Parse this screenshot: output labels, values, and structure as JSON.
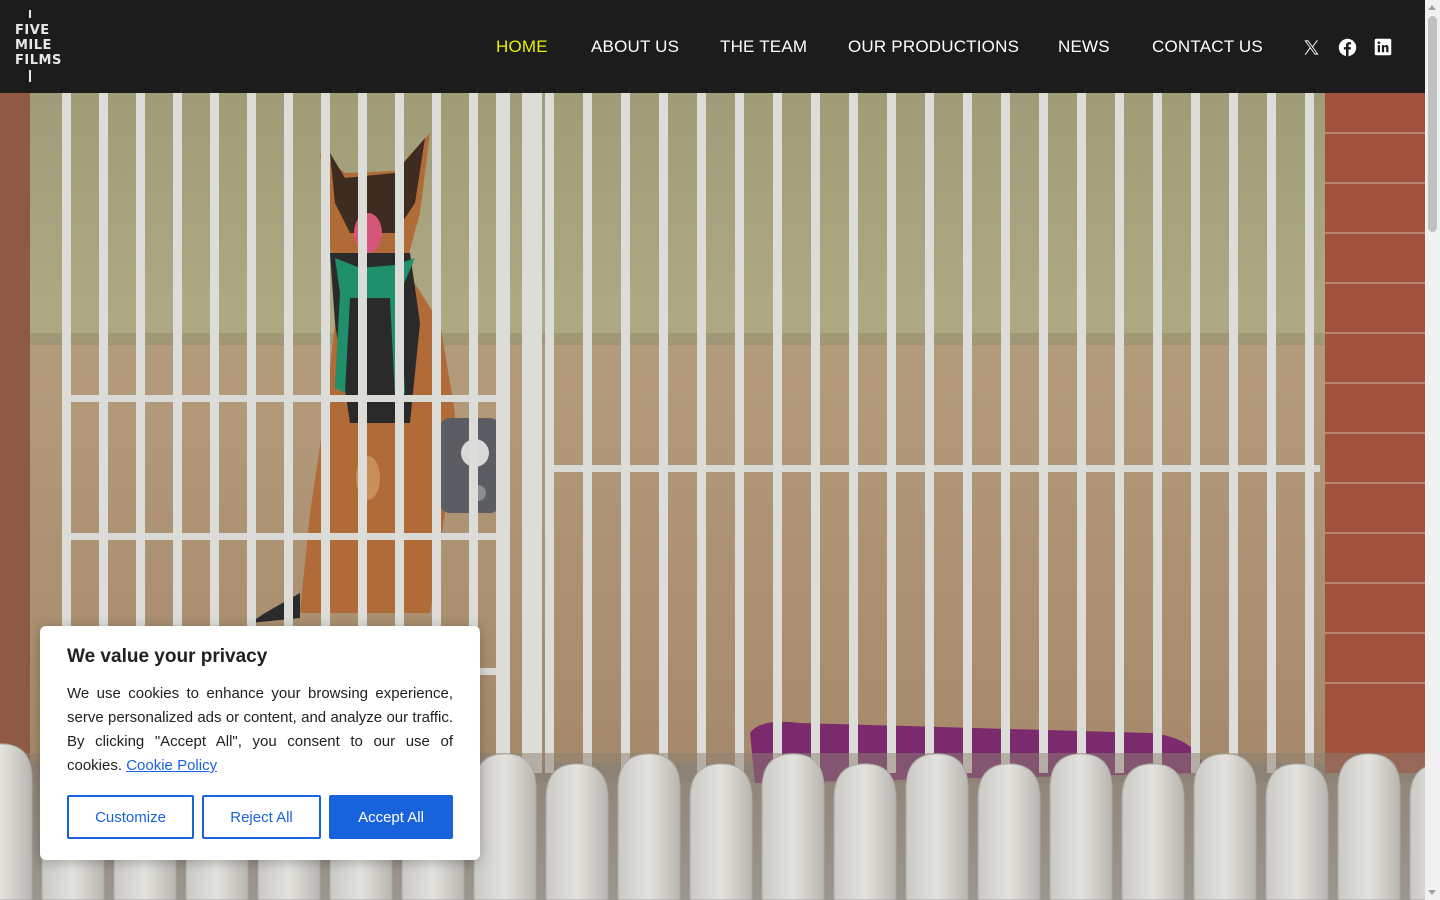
{
  "brand": {
    "logo_lines": [
      "FIVE",
      "MILE",
      "FILMS"
    ]
  },
  "nav": {
    "items": [
      {
        "label": "HOME",
        "active": true
      },
      {
        "label": "ABOUT US",
        "active": false
      },
      {
        "label": "THE TEAM",
        "active": false
      },
      {
        "label": "OUR PRODUCTIONS",
        "active": false
      },
      {
        "label": "NEWS",
        "active": false
      },
      {
        "label": "CONTACT US",
        "active": false
      }
    ],
    "social": [
      "x-icon",
      "facebook-icon",
      "linkedin-icon"
    ]
  },
  "hero": {
    "scroll_icon": "chevron-down-icon"
  },
  "cookie": {
    "title": "We value your privacy",
    "body": "We use cookies to enhance your browsing experience, serve personalized ads or content, and analyze our traffic. By clicking \"Accept All\", you consent to our use of cookies.",
    "policy_link": "Cookie Policy",
    "buttons": {
      "customize": "Customize",
      "reject": "Reject All",
      "accept": "Accept All"
    }
  },
  "colors": {
    "header_bg": "#1c1c1c",
    "nav_active": "#e7f000",
    "nav_text": "#ffffff",
    "cookie_accent": "#1863dc"
  }
}
